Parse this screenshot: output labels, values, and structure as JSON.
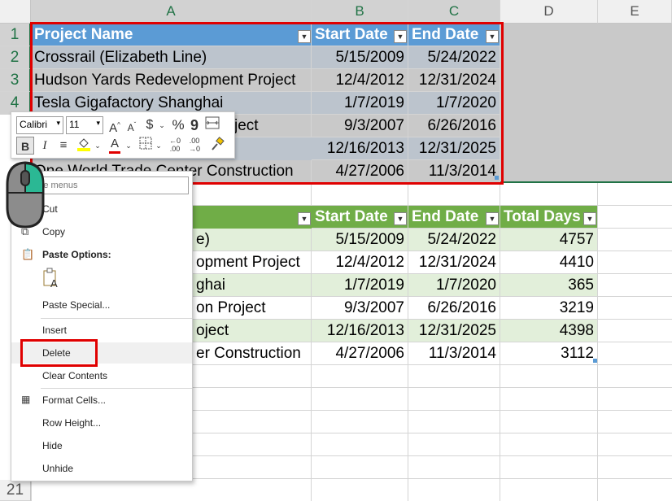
{
  "columns": [
    "A",
    "B",
    "C",
    "D",
    "E"
  ],
  "rows_top": [
    "1",
    "2",
    "3",
    "4"
  ],
  "row_bottom": "21",
  "table1": {
    "headers": [
      "Project Name",
      "Start Date",
      "End Date"
    ],
    "rows": [
      [
        "Crossrail (Elizabeth Line)",
        "5/15/2009",
        "5/24/2022"
      ],
      [
        "Hudson Yards Redevelopment Project",
        "12/4/2012",
        "12/31/2024"
      ],
      [
        "Tesla Gigafactory Shanghai",
        "1/7/2019",
        "1/7/2020"
      ],
      [
        "ject",
        "9/3/2007",
        "6/26/2016"
      ],
      [
        "",
        "12/16/2013",
        "12/31/2025"
      ],
      [
        "One World Trade Center Construction",
        "4/27/2006",
        "11/3/2014"
      ]
    ]
  },
  "table2": {
    "headers": [
      "Start Date",
      "End Date",
      "Total Days"
    ],
    "rows": [
      [
        "e)",
        "5/15/2009",
        "5/24/2022",
        "4757"
      ],
      [
        "opment Project",
        "12/4/2012",
        "12/31/2024",
        "4410"
      ],
      [
        "ghai",
        "1/7/2019",
        "1/7/2020",
        "365"
      ],
      [
        "on Project",
        "9/3/2007",
        "6/26/2016",
        "3219"
      ],
      [
        "oject",
        "12/16/2013",
        "12/31/2025",
        "4398"
      ],
      [
        "er Construction",
        "4/27/2006",
        "11/3/2014",
        "3112"
      ]
    ]
  },
  "mini_toolbar": {
    "font_name": "Calibri",
    "font_size": "11"
  },
  "context_menu": {
    "search_placeholder": "h the menus",
    "cut": "Cut",
    "copy": "Copy",
    "paste_options": "Paste Options:",
    "paste_special": "Paste Special...",
    "insert": "Insert",
    "delete": "Delete",
    "clear_contents": "Clear Contents",
    "format_cells": "Format Cells...",
    "row_height": "Row Height...",
    "hide": "Hide",
    "unhide": "Unhide"
  },
  "colors": {
    "table1_header": "#5b9bd5",
    "table1_band": "#bfc6cf",
    "table1_band_alt": "#c9c9c9",
    "table2_header": "#70ad47",
    "table2_band": "#e2efda",
    "selection_outline": "#e00000",
    "excel_green": "#217346"
  }
}
